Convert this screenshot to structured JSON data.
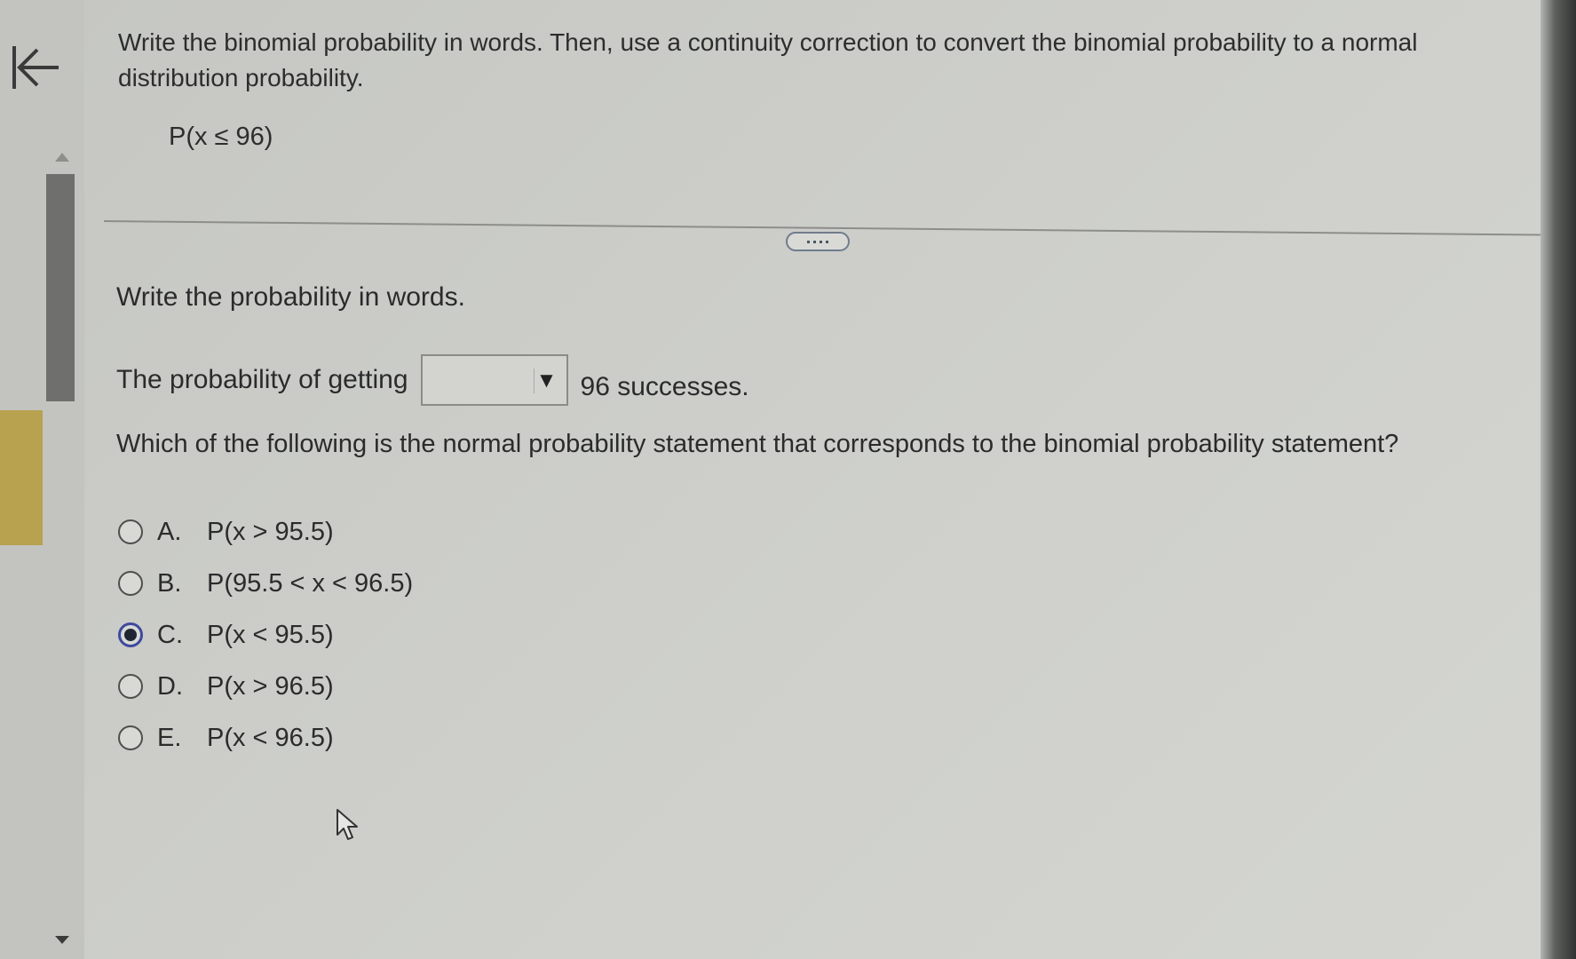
{
  "navigation": {
    "back_icon": "back-arrow-icon"
  },
  "question": {
    "instructions": "Write the binomial probability in words. Then, use a continuity correction to convert the binomial probability to a normal distribution probability.",
    "given": "P(x ≤ 96)"
  },
  "part1": {
    "prompt": "Write the probability in words.",
    "sentence_prefix": "The probability of getting",
    "dropdown_value": "",
    "sentence_suffix": "96 successes."
  },
  "part2": {
    "prompt": "Which of the following is the normal probability statement that corresponds to the binomial probability statement?",
    "options": [
      {
        "letter": "A.",
        "text": "P(x > 95.5)",
        "selected": false
      },
      {
        "letter": "B.",
        "text": "P(95.5 < x < 96.5)",
        "selected": false
      },
      {
        "letter": "C.",
        "text": "P(x < 95.5)",
        "selected": true
      },
      {
        "letter": "D.",
        "text": "P(x > 96.5)",
        "selected": false
      },
      {
        "letter": "E.",
        "text": "P(x < 96.5)",
        "selected": false
      }
    ]
  },
  "colors": {
    "background": "#c9cac6",
    "selected_radio": "#1e2633",
    "accent_yellow": "#b8a14f"
  }
}
